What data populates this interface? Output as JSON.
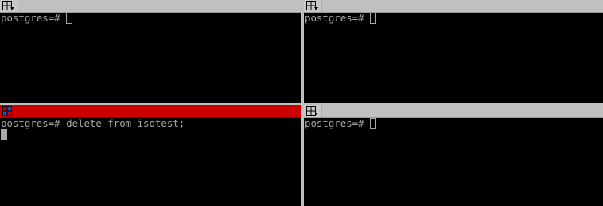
{
  "panes": {
    "top_left": {
      "active": false,
      "prompt": "postgres=# ",
      "input": "",
      "cursor_style": "hollow"
    },
    "top_right": {
      "active": false,
      "prompt": "postgres=# ",
      "input": "",
      "cursor_style": "hollow"
    },
    "bottom_left": {
      "active": true,
      "prompt": "postgres=# ",
      "input": "delete from isotest;",
      "cursor_style": "solid"
    },
    "bottom_right": {
      "active": false,
      "prompt": "postgres=# ",
      "input": "",
      "cursor_style": "hollow"
    }
  },
  "colors": {
    "active_titlebar": "#cc0000",
    "inactive_titlebar": "#c0c0c0",
    "terminal_bg": "#000000",
    "terminal_fg": "#a8a8a8"
  },
  "icons": {
    "pane_menu": "pane-menu-icon"
  }
}
